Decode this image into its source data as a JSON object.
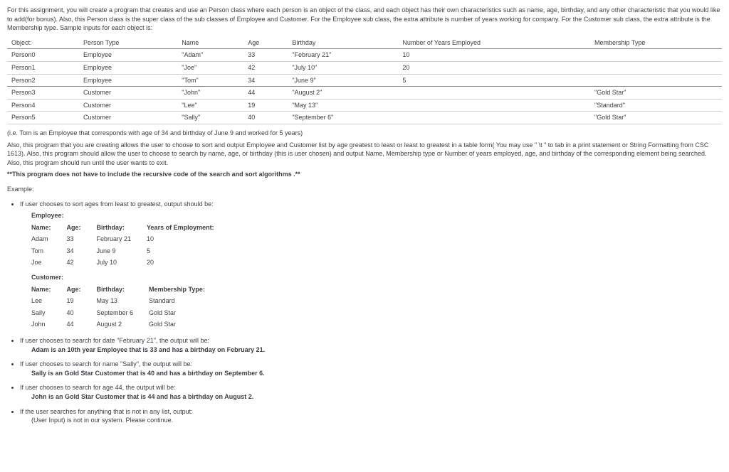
{
  "intro": "For this assignment, you will create a program that creates and use an Person class where each person is an object of the class, and each object has their own characteristics such as name, age, birthday, and any other characteristic that you would like to add(for bonus). Also, this Person class is the super class of the sub classes of Employee and Customer. For the Employee sub class, the extra attribute is number of years working for company. For the Customer sub class, the extra attribute is the Membership type. Sample inputs for each object is:",
  "table": {
    "headers": [
      "Object:",
      "Person Type",
      "Name",
      "Age",
      "Birthday",
      "Number of Years Employed",
      "Membership Type"
    ],
    "rows": [
      [
        "Person0",
        "Employee",
        "\"Adam\"",
        "33",
        "\"February 21\"",
        "10",
        ""
      ],
      [
        "Person1",
        "Employee",
        "\"Joe\"",
        "42",
        "\"July 10\"",
        "20",
        ""
      ],
      [
        "Person2",
        "Employee",
        "\"Tom\"",
        "34",
        "\"June 9\"",
        "5",
        ""
      ],
      [
        "Person3",
        "Customer",
        "\"John\"",
        "44",
        "\"August 2\"",
        "",
        "\"Gold Star\""
      ],
      [
        "Person4",
        "Customer",
        "\"Lee\"",
        "19",
        "\"May 13\"",
        "",
        "\"Standard\""
      ],
      [
        "Person5",
        "Customer",
        "\"Sally\"",
        "40",
        "\"September 6\"",
        "",
        "\"Gold Star\""
      ]
    ]
  },
  "note1": "(i.e. Tom is an Employee that corresponds with age of 34 and birthday of June 9 and worked for 5 years)",
  "note2": "Also, this program that you are creating allows the user to choose to sort and output Employee and Customer list by age greatest to least or least to greatest in a table form( You may use \" \\t \" to tab in a print statement or String Formatting from CSC 1613). Also, this program should allow the user to choose to search by name, age, or birthday (this is user chosen) and output Name, Membership type or Number of years employed, age, and birthday of the corresponding element being searched. Also, this program should run until the user wants to exit.",
  "note3": "**This program does not have to include the recursive code of the search and sort algorithms .**",
  "exampleLabel": "Example:",
  "bullet1": "If user chooses to sort ages from least to greatest, output should be:",
  "empLabel": "Employee:",
  "empHeaders": [
    "Name:",
    "Age:",
    "Birthday:",
    "Years of Employment:"
  ],
  "empRows": [
    [
      "Adam",
      "33",
      "February 21",
      "10"
    ],
    [
      "Tom",
      "34",
      "June 9",
      "5"
    ],
    [
      "Joe",
      "42",
      "July 10",
      "20"
    ]
  ],
  "custLabel": "Customer:",
  "custHeaders": [
    "Name:",
    "Age:",
    "Birthday:",
    "Membership Type:"
  ],
  "custRows": [
    [
      "Lee",
      "19",
      "May 13",
      "Standard"
    ],
    [
      "Sally",
      "40",
      "September 6",
      "Gold Star"
    ],
    [
      "John",
      "44",
      "August 2",
      "Gold Star"
    ]
  ],
  "b2a": "If user chooses to search for date \"February 21\", the output will be:",
  "b2b": "Adam is an 10th year Employee that is 33 and has a birthday on February 21.",
  "b3a": "If user chooses to search for name \"Sally\", the output will be:",
  "b3b": "Sally is an Gold Star Customer that is 40 and has a birthday on September 6.",
  "b4a": "If user chooses to search for age 44, the output will be:",
  "b4b": "John is an Gold Star Customer that is 44 and has a birthday on August 2.",
  "b5a": "If the user searches for anything that is not in any list, output:",
  "b5b": "(User Input) is not in our system. Please continue."
}
